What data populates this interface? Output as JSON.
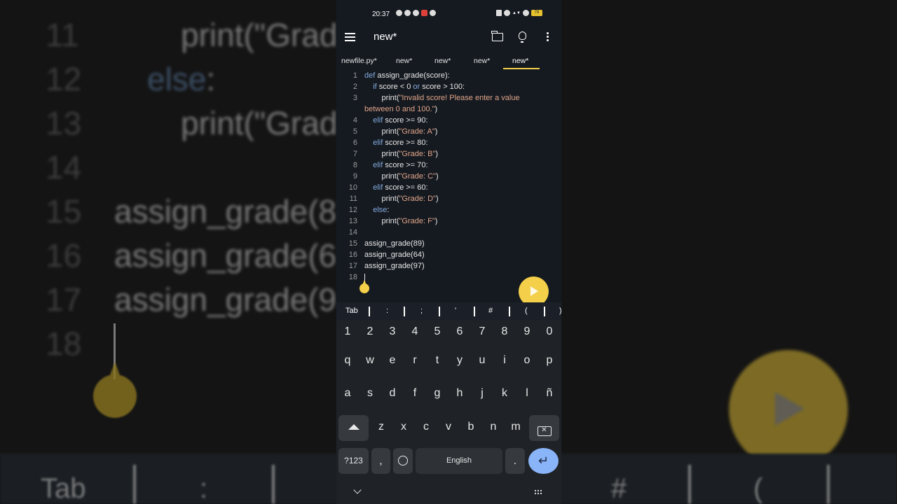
{
  "status_bar": {
    "time": "20:37",
    "battery": "79"
  },
  "toolbar": {
    "title": "new*"
  },
  "tabs": [
    {
      "label": "newfile.py*"
    },
    {
      "label": "new*"
    },
    {
      "label": "new*"
    },
    {
      "label": "new*"
    },
    {
      "label": "new*",
      "active": true
    }
  ],
  "editor": {
    "lines": [
      {
        "n": "1",
        "code": [
          [
            "kw",
            "def"
          ],
          [
            "t",
            " assign_grade(score):"
          ]
        ]
      },
      {
        "n": "2",
        "code": [
          [
            "t",
            "    "
          ],
          [
            "kw",
            "if"
          ],
          [
            "t",
            " score < 0 "
          ],
          [
            "kw",
            "or"
          ],
          [
            "t",
            " score > 100:"
          ]
        ]
      },
      {
        "n": "3",
        "code": [
          [
            "t",
            "        print("
          ],
          [
            "str",
            "\"Invalid score! Please enter a value"
          ]
        ]
      },
      {
        "n": "",
        "code": [
          [
            "str",
            "between 0 and 100.\""
          ],
          [
            "t",
            ")"
          ]
        ]
      },
      {
        "n": "4",
        "code": [
          [
            "t",
            "    "
          ],
          [
            "kw",
            "elif"
          ],
          [
            "t",
            " score >= 90:"
          ]
        ]
      },
      {
        "n": "5",
        "code": [
          [
            "t",
            "        print("
          ],
          [
            "str",
            "\"Grade: A\""
          ],
          [
            "t",
            ")"
          ]
        ]
      },
      {
        "n": "6",
        "code": [
          [
            "t",
            "    "
          ],
          [
            "kw",
            "elif"
          ],
          [
            "t",
            " score >= 80:"
          ]
        ]
      },
      {
        "n": "7",
        "code": [
          [
            "t",
            "        print("
          ],
          [
            "str",
            "\"Grade: B\""
          ],
          [
            "t",
            ")"
          ]
        ]
      },
      {
        "n": "8",
        "code": [
          [
            "t",
            "    "
          ],
          [
            "kw",
            "elif"
          ],
          [
            "t",
            " score >= 70:"
          ]
        ]
      },
      {
        "n": "9",
        "code": [
          [
            "t",
            "        print("
          ],
          [
            "str",
            "\"Grade: C\""
          ],
          [
            "t",
            ")"
          ]
        ]
      },
      {
        "n": "10",
        "code": [
          [
            "t",
            "    "
          ],
          [
            "kw",
            "elif"
          ],
          [
            "t",
            " score >= 60:"
          ]
        ]
      },
      {
        "n": "11",
        "code": [
          [
            "t",
            "        print("
          ],
          [
            "str",
            "\"Grade: D\""
          ],
          [
            "t",
            ")"
          ]
        ]
      },
      {
        "n": "12",
        "code": [
          [
            "t",
            "    "
          ],
          [
            "kw",
            "else"
          ],
          [
            "t",
            ":"
          ]
        ]
      },
      {
        "n": "13",
        "code": [
          [
            "t",
            "        print("
          ],
          [
            "str",
            "\"Grade: F\""
          ],
          [
            "t",
            ")"
          ]
        ]
      },
      {
        "n": "14",
        "code": []
      },
      {
        "n": "15",
        "code": [
          [
            "t",
            "assign_grade(89)"
          ]
        ]
      },
      {
        "n": "16",
        "code": [
          [
            "t",
            "assign_grade(64)"
          ]
        ]
      },
      {
        "n": "17",
        "code": [
          [
            "t",
            "assign_grade(97)"
          ]
        ]
      },
      {
        "n": "18",
        "code": []
      }
    ]
  },
  "symbol_bar": [
    "Tab",
    ":",
    ";",
    "'",
    "#",
    "(",
    ")"
  ],
  "keyboard": {
    "numbers": [
      "1",
      "2",
      "3",
      "4",
      "5",
      "6",
      "7",
      "8",
      "9",
      "0"
    ],
    "row1": [
      "q",
      "w",
      "e",
      "r",
      "t",
      "y",
      "u",
      "i",
      "o",
      "p"
    ],
    "row2": [
      "a",
      "s",
      "d",
      "f",
      "g",
      "h",
      "j",
      "k",
      "l",
      "ñ"
    ],
    "row3": [
      "z",
      "x",
      "c",
      "v",
      "b",
      "n",
      "m"
    ],
    "symbols_key": "?123",
    "comma": ",",
    "space_label": "English",
    "period": "."
  },
  "background": {
    "lines": [
      {
        "n": "11",
        "code": [
          [
            "t",
            "print(\"Grad"
          ]
        ]
      },
      {
        "n": "12",
        "code": [
          [
            "kw",
            "else"
          ],
          [
            "t",
            ":"
          ]
        ]
      },
      {
        "n": "13",
        "code": [
          [
            "t",
            "print(\"Grad"
          ]
        ]
      },
      {
        "n": "14",
        "code": []
      },
      {
        "n": "15",
        "code": [
          [
            "t",
            "assign_grade(8"
          ]
        ]
      },
      {
        "n": "16",
        "code": [
          [
            "t",
            "assign_grade(6"
          ]
        ]
      },
      {
        "n": "17",
        "code": [
          [
            "t",
            "assign_grade(9"
          ]
        ]
      },
      {
        "n": "18",
        "code": []
      }
    ],
    "bar": [
      "Tab",
      ":",
      "#",
      "("
    ]
  }
}
